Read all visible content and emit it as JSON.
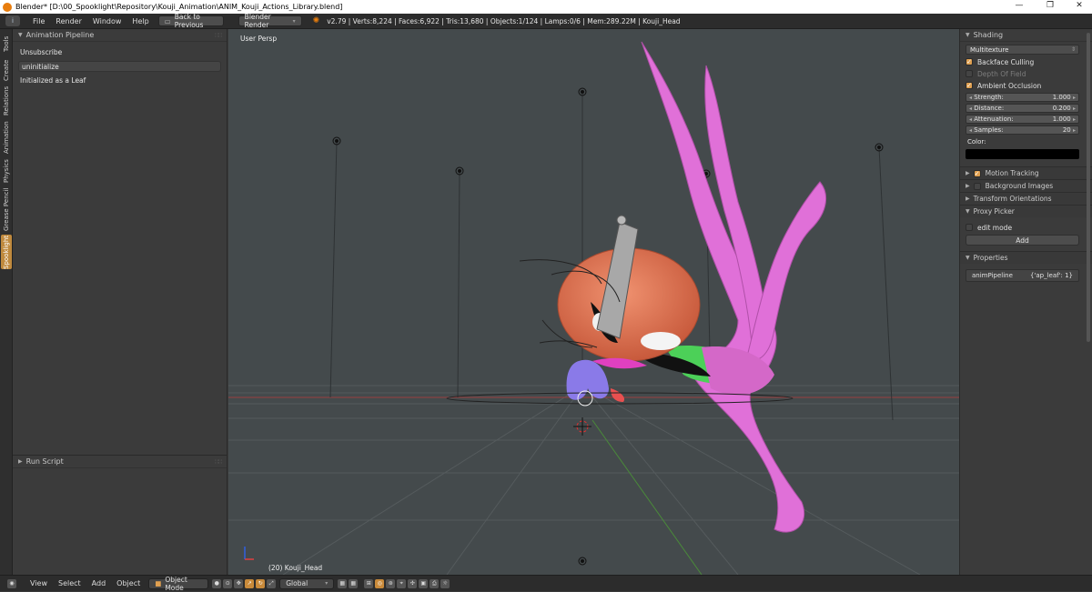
{
  "window": {
    "title": "Blender* [D:\\00_Spooklight\\Repository\\Kouji_Animation\\ANIM_Kouji_Actions_Library.blend]",
    "minimize": "—",
    "maximize": "❐",
    "close": "✕"
  },
  "infobar": {
    "menus": [
      "File",
      "Render",
      "Window",
      "Help"
    ],
    "back_label": "Back to Previous",
    "engine": "Blender Render",
    "stats": "v2.79 | Verts:8,224 | Faces:6,922 | Tris:13,680 | Objects:1/124 | Lamps:0/6 | Mem:289.22M | Kouji_Head"
  },
  "left_tabs": [
    "Tools",
    "Create",
    "Relations",
    "Animation",
    "Physics",
    "Grease Pencil",
    "Spooklight"
  ],
  "tool_shelf": {
    "panel_title": "Animation Pipeline",
    "unsubscribe": "Unsubscribe",
    "uninitialize": "uninitialize",
    "status": "Initialized as a Leaf",
    "run_script_title": "Run Script"
  },
  "viewport": {
    "view_label": "User Persp",
    "object_label": "(20) Kouji_Head"
  },
  "properties": {
    "shading": {
      "title": "Shading",
      "mode": "Multitexture",
      "backface_culling": "Backface Culling",
      "depth_of_field": "Depth Of Field",
      "ambient_occlusion": "Ambient Occlusion",
      "strength_label": "Strength:",
      "strength": "1.000",
      "distance_label": "Distance:",
      "distance": "0.200",
      "attenuation_label": "Attenuation:",
      "attenuation": "1.000",
      "samples_label": "Samples:",
      "samples": "20",
      "color_label": "Color:"
    },
    "motion_tracking": "Motion Tracking",
    "background_images": "Background Images",
    "transform_orientations": "Transform Orientations",
    "proxy_picker": {
      "title": "Proxy Picker",
      "edit_mode": "edit mode",
      "add": "Add"
    },
    "custom_props": {
      "title": "Properties",
      "key": "animPipeline",
      "value": "{'ap_leaf': 1}"
    }
  },
  "bottombar": {
    "menus": [
      "View",
      "Select",
      "Add",
      "Object"
    ],
    "mode": "Object Mode",
    "orientation": "Global"
  },
  "colors": {
    "accent": "#e0a050",
    "active_tab": "#c08a3e",
    "magenta_mesh": "#e070d8",
    "head_orange": "#e07a55"
  }
}
